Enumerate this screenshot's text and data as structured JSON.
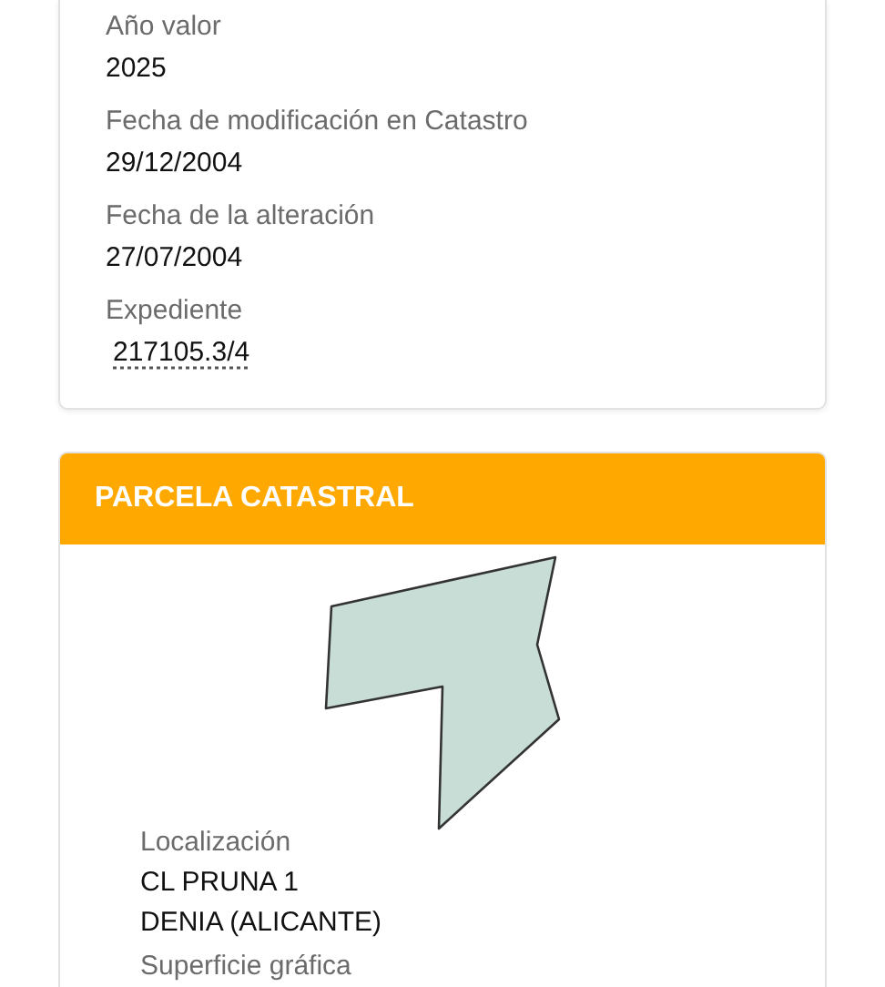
{
  "info_card": {
    "fields": [
      {
        "label": "Año valor",
        "kind": "text",
        "lines": [
          "2025"
        ]
      },
      {
        "label": "Fecha de modificación en Catastro",
        "kind": "text",
        "lines": [
          "29/12/2004"
        ]
      },
      {
        "label": "Fecha de la alteración",
        "kind": "text",
        "lines": [
          "27/07/2004"
        ]
      },
      {
        "label": "Expediente",
        "kind": "link",
        "lines": [
          "217105.3/4"
        ]
      }
    ]
  },
  "parcel_card": {
    "title": "PARCELA CATASTRAL",
    "fields": [
      {
        "label": "Localización",
        "kind": "text",
        "lines": [
          "CL PRUNA 1",
          "DENIA (ALICANTE)"
        ]
      },
      {
        "label": "Superficie gráfica"
      }
    ]
  }
}
